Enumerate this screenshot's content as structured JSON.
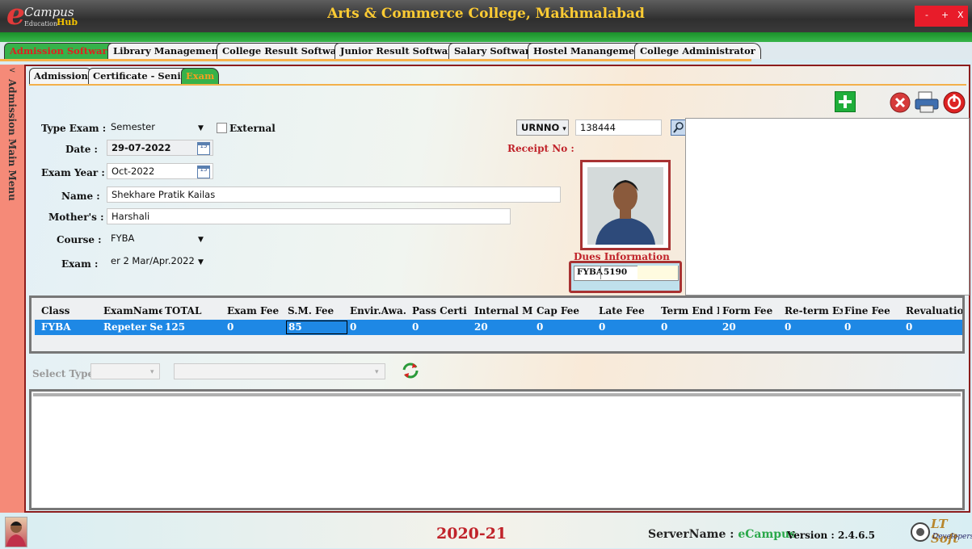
{
  "app": {
    "logo_e": "e",
    "logo_campus": "Campus",
    "logo_education": "Education",
    "logo_hub": "Hub",
    "college_title": "Arts & Commerce College, Makhmalabad",
    "win_minimize": "-",
    "win_maximize": "+",
    "win_close": "X"
  },
  "main_tabs": [
    {
      "label": "Admission Software",
      "active": true
    },
    {
      "label": "Library Managements",
      "active": false
    },
    {
      "label": "College Result Software",
      "active": false
    },
    {
      "label": "Junior Result Software",
      "active": false
    },
    {
      "label": "Salary Software",
      "active": false
    },
    {
      "label": "Hostel Manangement",
      "active": false
    },
    {
      "label": "College Administrator",
      "active": false
    }
  ],
  "side_menu": {
    "arrow": "<",
    "label": "Admission Main Menu"
  },
  "sub_tabs": [
    {
      "label": "Admission",
      "active": false
    },
    {
      "label": "Certificate - Senior",
      "active": false
    },
    {
      "label": "Exam",
      "active": true
    }
  ],
  "form": {
    "type_exam_label": "Type Exam :",
    "type_exam_value": "Semester",
    "external_label": "External",
    "external_checked": false,
    "date_label": "Date :",
    "date_value": "29-07-2022",
    "exam_year_label": "Exam Year :",
    "exam_year_value": "Oct-2022",
    "name_label": "Name :",
    "name_value": "Shekhare Pratik Kailas",
    "mother_label": "Mother's :",
    "mother_value": "Harshali",
    "course_label": "Course :",
    "course_value": "FYBA",
    "exam_label": "Exam :",
    "exam_value": "er 2 Mar/Apr.2022",
    "urn_select": "URNNO",
    "urn_value": "138444",
    "receipt_label": "Receipt No :",
    "dues_title": "Dues Information",
    "dues_class": "FYBA",
    "dues_amount": "5190",
    "calendar_icon_text": "15"
  },
  "grid": {
    "headers": [
      "Class",
      "ExamName",
      "TOTAL",
      "Exam Fee",
      "S.M. Fee",
      "Envir.Awa.",
      "Pass Certi",
      "Internal M",
      "Cap Fee",
      "Late Fee",
      "Term End Exam",
      "Form Fee",
      "Re-term Exam",
      "Fine Fee",
      "Revaluatio"
    ],
    "row": [
      "FYBA",
      "Repeter Se",
      "125",
      "0",
      "85",
      "0",
      "0",
      "20",
      "0",
      "0",
      "0",
      "20",
      "0",
      "0",
      "0"
    ]
  },
  "select_type": {
    "label": "Select Type",
    "value1": "",
    "value2": ""
  },
  "footer": {
    "year": "2020-21",
    "server_label": "ServerName :",
    "server_name": "eCampus",
    "version_label": "Version :",
    "version_value": "2.4.6.5",
    "brand": "LT Soft",
    "brand_sub": "Developers"
  },
  "colors": {
    "accent_green": "#36b24a",
    "accent_red": "#c0232a",
    "row_blue": "#1e88e5",
    "title_gold": "#ffcc33"
  }
}
